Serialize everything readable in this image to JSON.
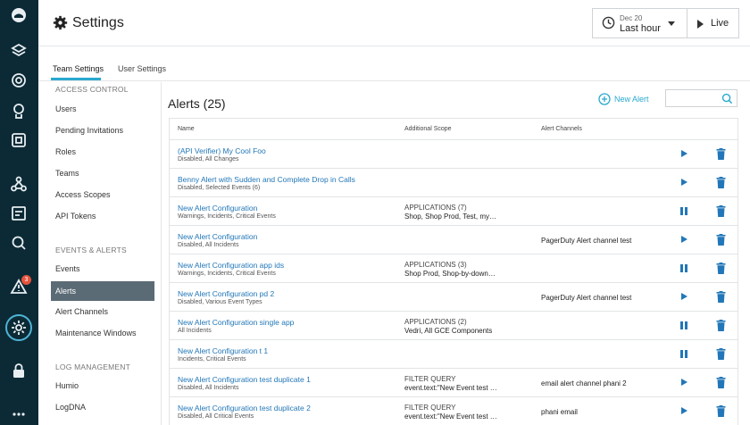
{
  "rail": {
    "icons": [
      "logo-icon",
      "layers-icon",
      "globe-icon",
      "rocket-icon",
      "dashboard-icon",
      "nodes-icon",
      "applications-icon",
      "search-icon",
      "alert-icon",
      "settings-icon",
      "lock-icon",
      "more-icon"
    ],
    "alert_badge": "3"
  },
  "header": {
    "title": "Settings",
    "time_picker": {
      "date": "Dec 20",
      "range": "Last hour"
    },
    "live_label": "Live"
  },
  "tabs": [
    {
      "label": "Team Settings",
      "active": true
    },
    {
      "label": "User Settings",
      "active": false
    }
  ],
  "menu": {
    "sections": [
      {
        "heading": "ACCESS CONTROL",
        "items": [
          "Users",
          "Pending Invitations",
          "Roles",
          "Teams",
          "Access Scopes",
          "API Tokens"
        ]
      },
      {
        "heading": "EVENTS & ALERTS",
        "items": [
          "Events",
          "Alerts",
          "Alert Channels",
          "Maintenance Windows"
        ]
      },
      {
        "heading": "LOG MANAGEMENT",
        "items": [
          "Humio",
          "LogDNA"
        ]
      }
    ],
    "active_item": "Alerts"
  },
  "main": {
    "title": "Alerts (25)",
    "new_alert_label": "New Alert",
    "search_placeholder": "",
    "columns": [
      "Name",
      "Additional Scope",
      "Alert Channels"
    ],
    "rows": [
      {
        "name": "(API Verifier) My Cool Foo",
        "sub": "Disabled, All Changes",
        "scope_h": "",
        "scope_v": "",
        "channel": "",
        "state": "play"
      },
      {
        "name": "Benny Alert with Sudden and Complete Drop in Calls",
        "sub": "Disabled, Selected Events (6)",
        "scope_h": "",
        "scope_v": "",
        "channel": "",
        "state": "play"
      },
      {
        "name": "New Alert Configuration",
        "sub": "Warnings, Incidents, Critical Events",
        "scope_h": "APPLICATIONS (7)",
        "scope_v": "Shop, Shop Prod, Test, my…",
        "channel": "",
        "state": "pause"
      },
      {
        "name": "New Alert Configuration",
        "sub": "Disabled, All Incidents",
        "scope_h": "",
        "scope_v": "",
        "channel": "PagerDuty Alert channel test",
        "state": "play"
      },
      {
        "name": "New Alert Configuration app ids",
        "sub": "Warnings, Incidents, Critical Events",
        "scope_h": "APPLICATIONS (3)",
        "scope_v": "Shop Prod, Shop-by-down…",
        "channel": "",
        "state": "pause"
      },
      {
        "name": "New Alert Configuration pd 2",
        "sub": "Disabled, Various Event Types",
        "scope_h": "",
        "scope_v": "",
        "channel": "PagerDuty Alert channel test",
        "state": "play"
      },
      {
        "name": "New Alert Configuration single app",
        "sub": "All Incidents",
        "scope_h": "APPLICATIONS (2)",
        "scope_v": "Vedri, All GCE Components",
        "channel": "",
        "state": "pause"
      },
      {
        "name": "New Alert Configuration t 1",
        "sub": "Incidents, Critical Events",
        "scope_h": "",
        "scope_v": "",
        "channel": "",
        "state": "pause"
      },
      {
        "name": "New Alert Configuration test duplicate 1",
        "sub": "Disabled, All Incidents",
        "scope_h": "FILTER QUERY",
        "scope_v": "event.text:\"New Event test …",
        "channel": "email alert channel phani 2",
        "state": "play"
      },
      {
        "name": "New Alert Configuration test duplicate 2",
        "sub": "Disabled, All Critical Events",
        "scope_h": "FILTER QUERY",
        "scope_v": "event.text:\"New Event test …",
        "channel": "phani email",
        "state": "play"
      }
    ]
  },
  "colors": {
    "rail": "#0b2a36",
    "accent": "#29a9cf",
    "link": "#2277b8",
    "badge": "#e5533c",
    "active_menu": "#5b6b76"
  }
}
